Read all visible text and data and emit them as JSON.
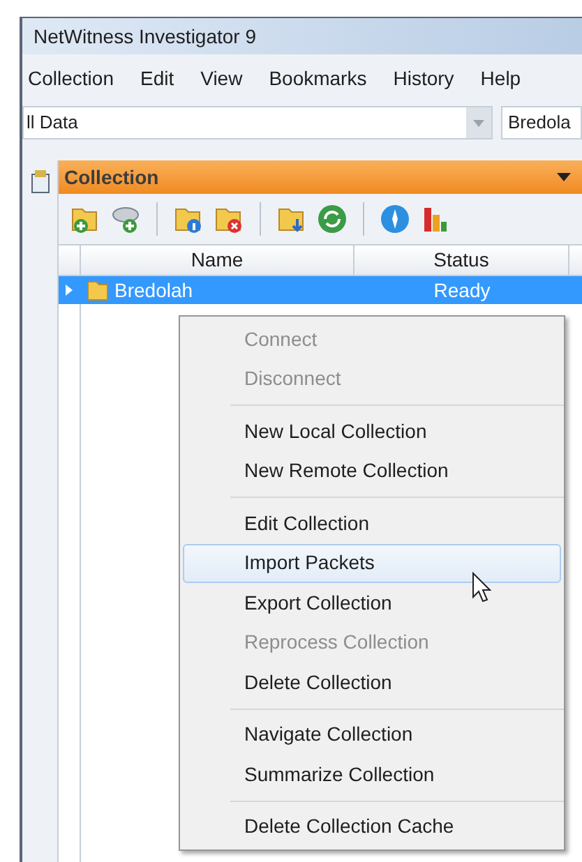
{
  "window": {
    "title": "NetWitness Investigator 9"
  },
  "menu_bar": [
    {
      "label": "Collection"
    },
    {
      "label": "Edit"
    },
    {
      "label": "View"
    },
    {
      "label": "Bookmarks"
    },
    {
      "label": "History"
    },
    {
      "label": "Help"
    }
  ],
  "address_bar": {
    "value": "ll Data",
    "second_value": "Bredola"
  },
  "panel": {
    "title": "Collection"
  },
  "table": {
    "columns": [
      "Name",
      "Status"
    ],
    "rows": [
      {
        "name": "Bredolah",
        "status": "Ready",
        "selected": true,
        "expanded": false
      }
    ]
  },
  "context_menu": [
    {
      "kind": "item",
      "label": "Connect",
      "disabled": true,
      "selected": false
    },
    {
      "kind": "item",
      "label": "Disconnect",
      "disabled": true,
      "selected": false
    },
    {
      "kind": "separator"
    },
    {
      "kind": "item",
      "label": "New Local Collection",
      "disabled": false,
      "selected": false
    },
    {
      "kind": "item",
      "label": "New Remote Collection",
      "disabled": false,
      "selected": false
    },
    {
      "kind": "separator"
    },
    {
      "kind": "item",
      "label": "Edit Collection",
      "disabled": false,
      "selected": false
    },
    {
      "kind": "item",
      "label": "Import Packets",
      "disabled": false,
      "selected": true
    },
    {
      "kind": "item",
      "label": "Export Collection",
      "disabled": false,
      "selected": false
    },
    {
      "kind": "item",
      "label": "Reprocess Collection",
      "disabled": true,
      "selected": false
    },
    {
      "kind": "item",
      "label": "Delete Collection",
      "disabled": false,
      "selected": false
    },
    {
      "kind": "separator"
    },
    {
      "kind": "item",
      "label": "Navigate Collection",
      "disabled": false,
      "selected": false
    },
    {
      "kind": "item",
      "label": "Summarize Collection",
      "disabled": false,
      "selected": false
    },
    {
      "kind": "separator"
    },
    {
      "kind": "item",
      "label": "Delete Collection Cache",
      "disabled": false,
      "selected": false
    }
  ]
}
